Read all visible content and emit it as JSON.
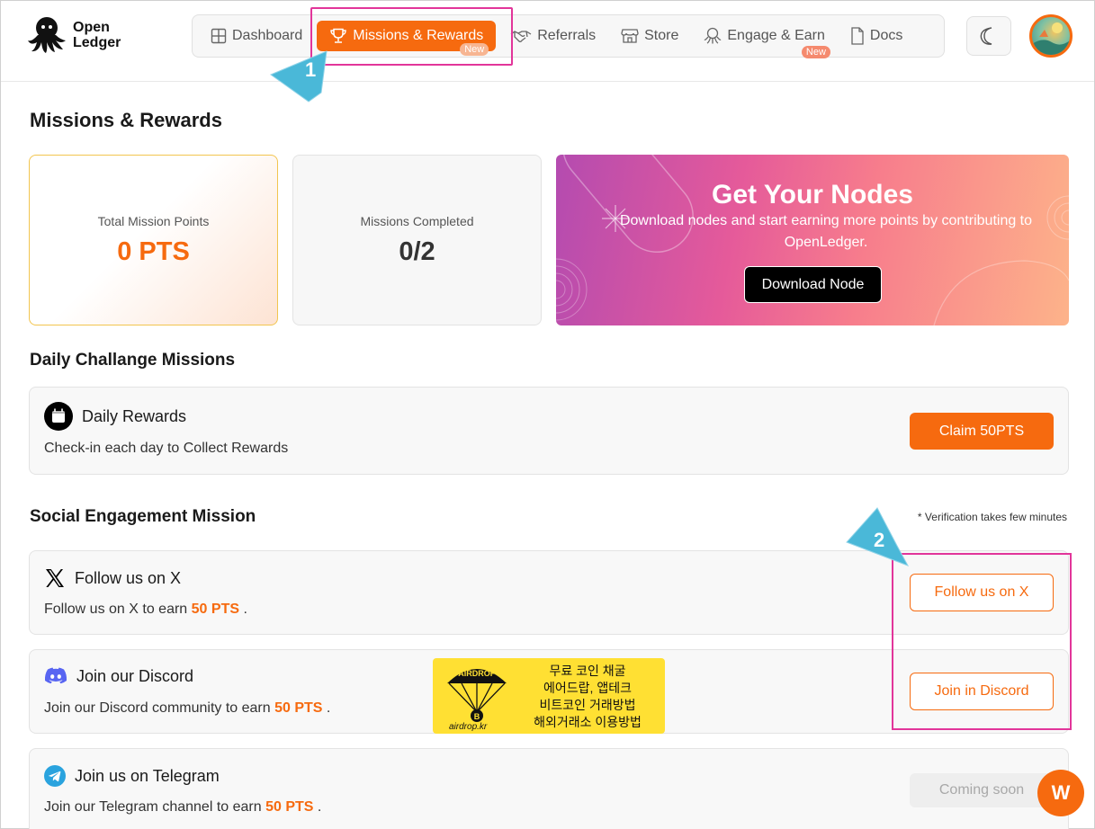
{
  "brand": {
    "line1": "Open",
    "line2": "Ledger"
  },
  "nav": {
    "items": [
      {
        "label": "Dashboard",
        "icon": "grid-icon"
      },
      {
        "label": "Missions & Rewards",
        "icon": "trophy-icon",
        "badge": "New",
        "active": true
      },
      {
        "label": "Referrals",
        "icon": "handshake-icon"
      },
      {
        "label": "Store",
        "icon": "store-icon"
      },
      {
        "label": "Engage & Earn",
        "icon": "octopus-icon",
        "badge": "New"
      },
      {
        "label": "Docs",
        "icon": "document-icon"
      }
    ]
  },
  "callouts": {
    "first": "1",
    "second": "2"
  },
  "page": {
    "title": "Missions & Rewards"
  },
  "stats": {
    "points_label": "Total Mission Points",
    "points_value": "0 PTS",
    "completed_label": "Missions Completed",
    "completed_value": "0/2"
  },
  "promo": {
    "title": "Get Your Nodes",
    "description": "Download nodes and start earning more points by contributing to OpenLedger.",
    "button": "Download Node"
  },
  "daily": {
    "section_title": "Daily Challange Missions",
    "title": "Daily Rewards",
    "description": "Check-in each day to Collect Rewards",
    "button": "Claim 50PTS"
  },
  "social": {
    "section_title": "Social Engagement Mission",
    "note": "* Verification takes few minutes",
    "missions": [
      {
        "title": "Follow us on X",
        "desc_prefix": "Follow us on X to earn",
        "points": "50 PTS",
        "desc_suffix": ".",
        "button": "Follow us on X",
        "state": "enabled"
      },
      {
        "title": "Join our Discord",
        "desc_prefix": "Join our Discord community to earn",
        "points": "50 PTS",
        "desc_suffix": ".",
        "button": "Join in Discord",
        "state": "enabled"
      },
      {
        "title": "Join us on Telegram",
        "desc_prefix": "Join our Telegram channel to earn",
        "points": "50 PTS",
        "desc_suffix": ".",
        "button": "Coming soon",
        "state": "disabled"
      }
    ]
  },
  "ad": {
    "badge": "AIRDROP",
    "lines": [
      "무료 코인 채굴",
      "에어드랍, 앱테크",
      "비트코인 거래방법",
      "해외거래소 이용방법"
    ],
    "tag": "airdrop.kr"
  },
  "fab": {
    "label": "W"
  },
  "colors": {
    "accent": "#f66a0f",
    "highlight": "#e2359a",
    "callout": "#4ab8d8"
  }
}
